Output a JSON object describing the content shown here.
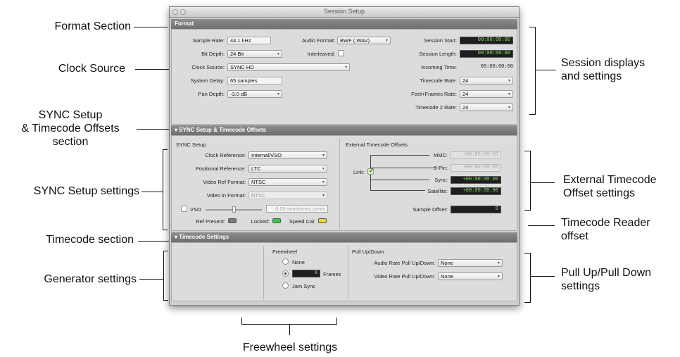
{
  "window": {
    "title": "Session Setup"
  },
  "callouts": {
    "format_section": "Format Section",
    "clock_source": "Clock Source",
    "sync_setup_line1": "SYNC Setup",
    "sync_setup_line2": "& Timecode Offsets",
    "sync_setup_line3": "section",
    "sync_setup_settings": "SYNC Setup settings",
    "timecode_section": "Timecode section",
    "generator_settings": "Generator settings",
    "freewheel_settings": "Freewheel settings",
    "session_displays_line1": "Session displays",
    "session_displays_line2": "and settings",
    "external_offsets_line1": "External Timecode",
    "external_offsets_line2": "Offset settings",
    "reader_offset_line1": "Timecode Reader",
    "reader_offset_line2": "offset",
    "pullup_line1": "Pull Up/Pull Down",
    "pullup_line2": "settings"
  },
  "format": {
    "header": "Format",
    "sample_rate_label": "Sample Rate:",
    "sample_rate": "44.1 kHz",
    "bit_depth_label": "Bit Depth:",
    "bit_depth": "24 Bit",
    "clock_source_label": "Clock Source:",
    "clock_source": "SYNC HD",
    "system_delay_label": "System Delay:",
    "system_delay": "65 samples",
    "pan_depth_label": "Pan Depth:",
    "pan_depth": "-3.0 dB",
    "audio_format_label": "Audio Format:",
    "audio_format": "BWF (.WAV)",
    "interleaved_label": "Interleaved:",
    "interleaved": false,
    "session_start_label": "Session Start:",
    "session_start": "00:00:00:00",
    "session_length_label": "Session Length:",
    "session_length": "00:00:00:00",
    "incoming_time_label": "Incoming Time:",
    "incoming_time": "00:00:00:00",
    "timecode_rate_label": "Timecode Rate:",
    "timecode_rate": "24",
    "feet_frames_rate_label": "Feet+Frames Rate:",
    "feet_frames_rate": "24",
    "timecode2_rate_label": "Timecode 2 Rate:",
    "timecode2_rate": "24"
  },
  "sync": {
    "header": "SYNC Setup & Timecode Offsets",
    "sync_setup_title": "SYNC Setup",
    "clock_reference_label": "Clock Reference:",
    "clock_reference": "Internal/VSO",
    "positional_reference_label": "Positional Reference:",
    "positional_reference": "LTC",
    "video_ref_format_label": "Video Ref Format:",
    "video_ref_format": "NTSC",
    "video_in_format_label": "Video In Format:",
    "video_in_format": "NTSC",
    "vso_label": "VSO",
    "vso_value": "0.00  semitones.cents",
    "ref_present_label": "Ref Present:",
    "locked_label": "Locked:",
    "speed_cal_label": "Speed Cal:",
    "led_colors": {
      "ref_present": "#7a7a7a",
      "locked": "#3fc24a",
      "speed_cal": "#f2d338"
    },
    "ext_offsets_title": "External Timecode Offsets",
    "link_label": "Link:",
    "link": true,
    "mmc_label": "MMC:",
    "mmc": "+00:00:00:00",
    "ninepin_label": "9-Pin:",
    "ninepin": "+00:00:00:00",
    "sync_label": "Sync:",
    "sync_offset": "+00:00:00:00",
    "satellite_label": "Satellite:",
    "satellite": "+00:00:00:00",
    "sample_offset_label": "Sample Offset:",
    "sample_offset": "0"
  },
  "timecode": {
    "header": "Timecode Settings",
    "freewheel_title": "Freewheel",
    "none_label": "None",
    "frames_value": "8",
    "frames_label": "Frames",
    "jam_sync_label": "Jam Sync",
    "selected_freewheel": "Frames",
    "pullup_title": "Pull Up/Down",
    "audio_pull_label": "Audio Rate Pull Up/Down:",
    "audio_pull": "None",
    "video_pull_label": "Video Rate Pull Up/Down:",
    "video_pull": "None"
  }
}
